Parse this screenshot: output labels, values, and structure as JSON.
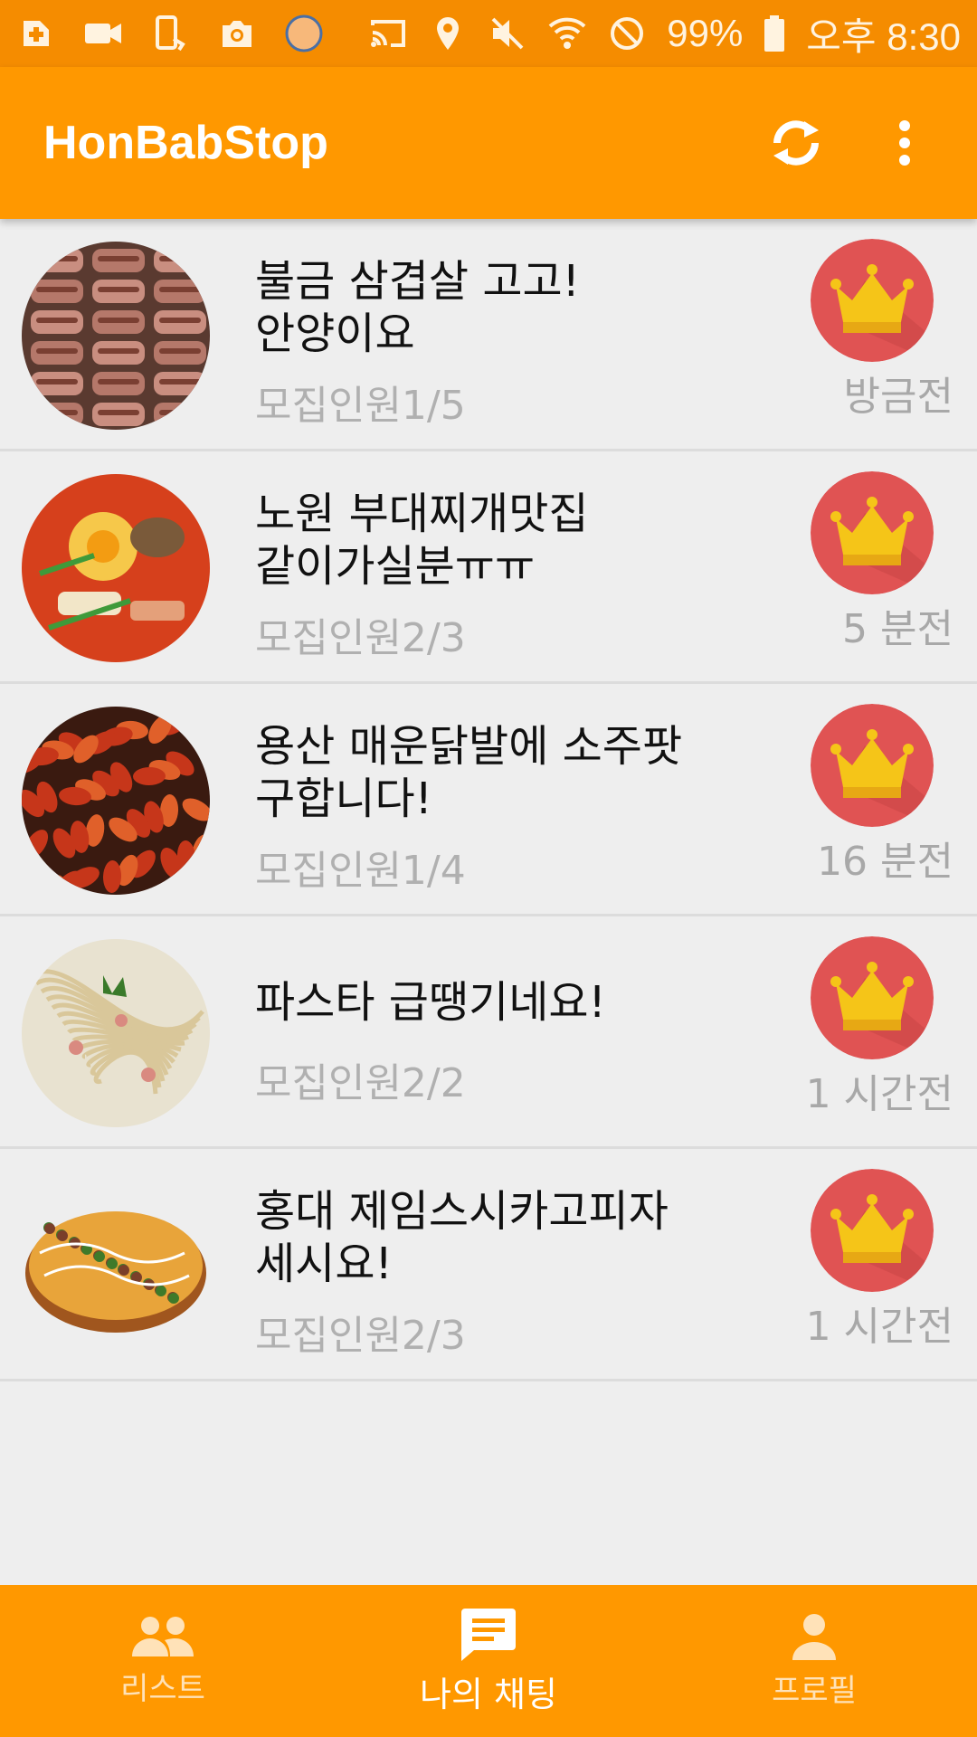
{
  "status_bar": {
    "battery": "99%",
    "time": "오후 8:30",
    "icons": [
      "add-app-icon",
      "video-icon",
      "phone-rotate-icon",
      "camera-icon",
      "circle-app-icon",
      "cast-icon",
      "location-icon",
      "mute-icon",
      "wifi-icon",
      "do-not-disturb-icon",
      "battery-icon"
    ]
  },
  "app_bar": {
    "title": "HonBabStop",
    "actions": [
      "refresh-icon",
      "more-vert-icon"
    ]
  },
  "chats": [
    {
      "title": "불금 삼겹살 고고!\n안양이요",
      "members": "모집인원1/5",
      "time": "방금전",
      "food": "pork-belly"
    },
    {
      "title": "노원 부대찌개맛집\n같이가실분ㅠㅠ",
      "members": "모집인원2/3",
      "time": "5 분전",
      "food": "army-stew"
    },
    {
      "title": "용산 매운닭발에 소주팟\n구합니다!",
      "members": "모집인원1/4",
      "time": "16 분전",
      "food": "spicy-chicken-feet"
    },
    {
      "title": "파스타 급땡기네요!",
      "members": "모집인원2/2",
      "time": "1 시간전",
      "food": "pasta"
    },
    {
      "title": "홍대 제임스시카고피자\n세시요!",
      "members": "모집인원2/3",
      "time": "1 시간전",
      "food": "pizza"
    }
  ],
  "colors": {
    "accent": "#ff9800",
    "status_bar": "#f58c00",
    "crown_badge": "#e05353",
    "crown": "#f5c518"
  },
  "bottom_nav": [
    {
      "label": "리스트",
      "icon": "people-icon",
      "active": false
    },
    {
      "label": "나의 채팅",
      "icon": "chat-icon",
      "active": true
    },
    {
      "label": "프로필",
      "icon": "person-icon",
      "active": false
    }
  ]
}
